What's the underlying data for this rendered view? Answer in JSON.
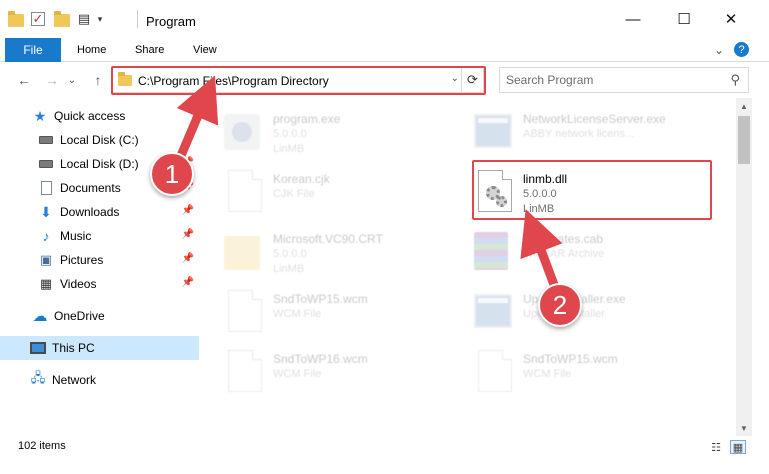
{
  "window": {
    "title": "Program",
    "minimize_glyph": "—",
    "maximize_glyph": "☐",
    "close_glyph": "✕"
  },
  "ribbon": {
    "file": "File",
    "home": "Home",
    "share": "Share",
    "view": "View",
    "expand_glyph": "⌄",
    "help_glyph": "?"
  },
  "address": {
    "path": "C:\\Program Files\\Program Directory",
    "back_glyph": "←",
    "forward_glyph": "→",
    "recent_glyph": "⌄",
    "up_glyph": "↑",
    "dropdown_glyph": "⌄",
    "refresh_glyph": "⟳"
  },
  "search": {
    "placeholder": "Search Program",
    "icon_glyph": "⚲"
  },
  "sidebar": {
    "quick_access": "Quick access",
    "local_c": "Local Disk (C:)",
    "local_d": "Local Disk (D:)",
    "documents": "Documents",
    "downloads": "Downloads",
    "music": "Music",
    "pictures": "Pictures",
    "videos": "Videos",
    "onedrive": "OneDrive",
    "this_pc": "This PC",
    "network": "Network"
  },
  "files": {
    "program_exe": {
      "name": "program.exe",
      "line2": "5.0.0.0",
      "line3": "LinMB"
    },
    "network_license": {
      "name": "NetworkLicenseServer.exe",
      "line2": "ABBY network licens...",
      "line3": ""
    },
    "korean": {
      "name": "Korean.cjk",
      "line2": "CJK File",
      "line3": ""
    },
    "linmb": {
      "name": "linmb.dll",
      "line2": "5.0.0.0",
      "line3": "LinMB"
    },
    "msvc": {
      "name": "Microsoft.VC90.CRT",
      "line2": "5.0.0.0",
      "line3": "LinMB"
    },
    "certificates": {
      "name": "certificates.cab",
      "line2": "WinRAR Archive",
      "line3": ""
    },
    "sndto15_left": {
      "name": "SndToWP15.wcm",
      "line2": "WCM File",
      "line3": ""
    },
    "updateinstaller": {
      "name": "UpdateInstaller.exe",
      "line2": "Updates installer",
      "line3": ""
    },
    "sndto16": {
      "name": "SndToWP16.wcm",
      "line2": "WCM File",
      "line3": ""
    },
    "sndto15_right": {
      "name": "SndToWP15.wcm",
      "line2": "WCM File",
      "line3": ""
    }
  },
  "status": {
    "count": "102 items"
  },
  "annotations": {
    "step1": "1",
    "step2": "2",
    "color": "#e0474c"
  }
}
